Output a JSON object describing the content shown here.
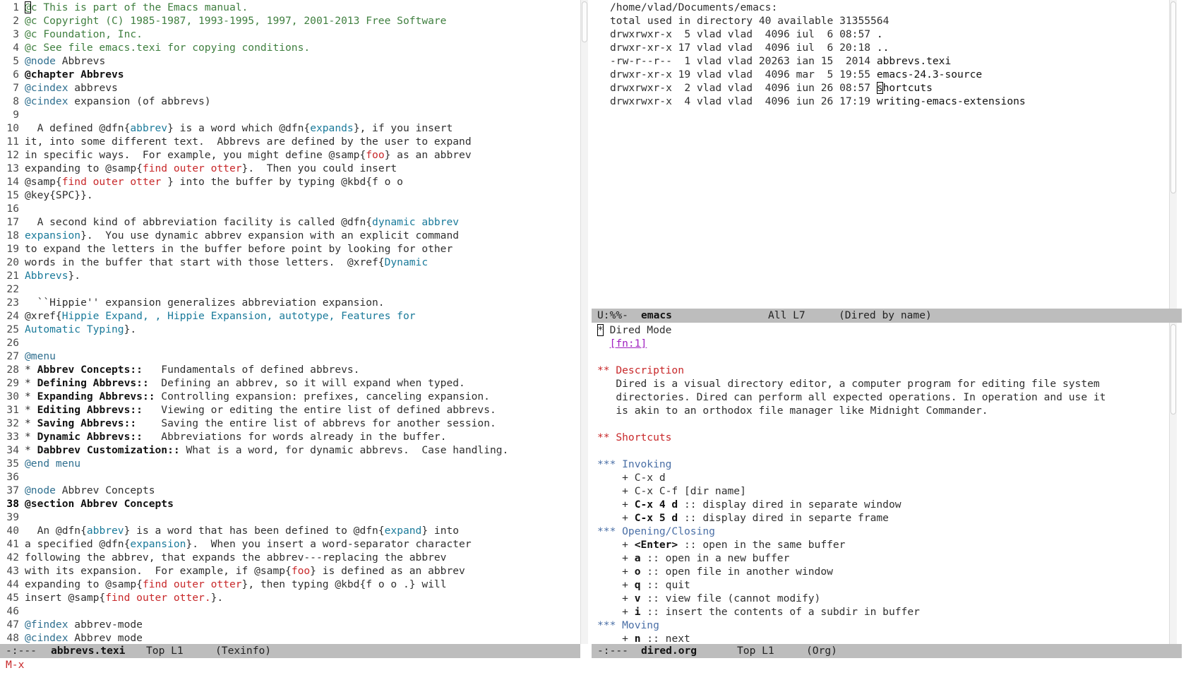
{
  "left_buffer": {
    "current_line": 38,
    "lines": [
      {
        "n": "1",
        "segs": [
          {
            "t": "@c This is part of the Emacs manual.",
            "c": "comment"
          }
        ]
      },
      {
        "n": "2",
        "segs": [
          {
            "t": "@c Copyright (C) 1985-1987, 1993-1995, 1997, 2001-2013 Free Software",
            "c": "comment"
          }
        ]
      },
      {
        "n": "3",
        "segs": [
          {
            "t": "@c Foundation, Inc.",
            "c": "comment"
          }
        ]
      },
      {
        "n": "4",
        "segs": [
          {
            "t": "@c See file emacs.texi for copying conditions.",
            "c": "comment"
          }
        ]
      },
      {
        "n": "5",
        "segs": [
          {
            "t": "@node",
            "c": "kw"
          },
          {
            "t": " Abbrevs",
            "c": "norm"
          }
        ]
      },
      {
        "n": "6",
        "segs": [
          {
            "t": "@chapter Abbrevs",
            "c": "bold"
          }
        ]
      },
      {
        "n": "7",
        "segs": [
          {
            "t": "@cindex",
            "c": "kw"
          },
          {
            "t": " abbrevs",
            "c": "norm"
          }
        ]
      },
      {
        "n": "8",
        "segs": [
          {
            "t": "@cindex",
            "c": "kw"
          },
          {
            "t": " expansion (of abbrevs)",
            "c": "norm"
          }
        ]
      },
      {
        "n": "9",
        "segs": []
      },
      {
        "n": "10",
        "segs": [
          {
            "t": "  A defined @dfn{",
            "c": "norm"
          },
          {
            "t": "abbrev",
            "c": "arg"
          },
          {
            "t": "} is a word which @dfn{",
            "c": "norm"
          },
          {
            "t": "expands",
            "c": "arg"
          },
          {
            "t": "}, if you insert",
            "c": "norm"
          }
        ]
      },
      {
        "n": "11",
        "segs": [
          {
            "t": "it, into some different text.  Abbrevs are defined by the user to expand",
            "c": "norm"
          }
        ]
      },
      {
        "n": "12",
        "segs": [
          {
            "t": "in specific ways.  For example, you might define @samp{",
            "c": "norm"
          },
          {
            "t": "foo",
            "c": "red"
          },
          {
            "t": "} as an abbrev",
            "c": "norm"
          }
        ]
      },
      {
        "n": "13",
        "segs": [
          {
            "t": "expanding to @samp{",
            "c": "norm"
          },
          {
            "t": "find outer otter",
            "c": "red"
          },
          {
            "t": "}.  Then you could insert",
            "c": "norm"
          }
        ]
      },
      {
        "n": "14",
        "segs": [
          {
            "t": "@samp{",
            "c": "norm"
          },
          {
            "t": "find outer otter ",
            "c": "red"
          },
          {
            "t": "} into the buffer by typing @kbd{f o o",
            "c": "norm"
          }
        ]
      },
      {
        "n": "15",
        "segs": [
          {
            "t": "@key{SPC}}.",
            "c": "norm"
          }
        ]
      },
      {
        "n": "16",
        "segs": []
      },
      {
        "n": "17",
        "segs": [
          {
            "t": "  A second kind of abbreviation facility is called @dfn{",
            "c": "norm"
          },
          {
            "t": "dynamic abbrev",
            "c": "arg"
          }
        ]
      },
      {
        "n": "18",
        "segs": [
          {
            "t": "expansion",
            "c": "arg"
          },
          {
            "t": "}.  You use dynamic abbrev expansion with an explicit command",
            "c": "norm"
          }
        ]
      },
      {
        "n": "19",
        "segs": [
          {
            "t": "to expand the letters in the buffer before point by looking for other",
            "c": "norm"
          }
        ]
      },
      {
        "n": "20",
        "segs": [
          {
            "t": "words in the buffer that start with those letters.  @xref{",
            "c": "norm"
          },
          {
            "t": "Dynamic",
            "c": "arg"
          }
        ]
      },
      {
        "n": "21",
        "segs": [
          {
            "t": "Abbrevs",
            "c": "arg"
          },
          {
            "t": "}.",
            "c": "norm"
          }
        ]
      },
      {
        "n": "22",
        "segs": []
      },
      {
        "n": "23",
        "segs": [
          {
            "t": "  ``Hippie'' expansion generalizes abbreviation expansion.",
            "c": "norm"
          }
        ]
      },
      {
        "n": "24",
        "segs": [
          {
            "t": "@xref{",
            "c": "norm"
          },
          {
            "t": "Hippie Expand, , Hippie Expansion, autotype, Features for",
            "c": "arg"
          }
        ]
      },
      {
        "n": "25",
        "segs": [
          {
            "t": "Automatic Typing",
            "c": "arg"
          },
          {
            "t": "}.",
            "c": "norm"
          }
        ]
      },
      {
        "n": "26",
        "segs": []
      },
      {
        "n": "27",
        "segs": [
          {
            "t": "@menu",
            "c": "kw"
          }
        ]
      },
      {
        "n": "28",
        "segs": [
          {
            "t": "* ",
            "c": "norm"
          },
          {
            "t": "Abbrev Concepts::",
            "c": "bold"
          },
          {
            "t": "   Fundamentals of defined abbrevs.",
            "c": "norm"
          }
        ]
      },
      {
        "n": "29",
        "segs": [
          {
            "t": "* ",
            "c": "norm"
          },
          {
            "t": "Defining Abbrevs::",
            "c": "bold"
          },
          {
            "t": "  Defining an abbrev, so it will expand when typed.",
            "c": "norm"
          }
        ]
      },
      {
        "n": "30",
        "segs": [
          {
            "t": "* ",
            "c": "norm"
          },
          {
            "t": "Expanding Abbrevs::",
            "c": "bold"
          },
          {
            "t": " Controlling expansion: prefixes, canceling expansion.",
            "c": "norm"
          }
        ]
      },
      {
        "n": "31",
        "segs": [
          {
            "t": "* ",
            "c": "norm"
          },
          {
            "t": "Editing Abbrevs::",
            "c": "bold"
          },
          {
            "t": "   Viewing or editing the entire list of defined abbrevs.",
            "c": "norm"
          }
        ]
      },
      {
        "n": "32",
        "segs": [
          {
            "t": "* ",
            "c": "norm"
          },
          {
            "t": "Saving Abbrevs::",
            "c": "bold"
          },
          {
            "t": "    Saving the entire list of abbrevs for another session.",
            "c": "norm"
          }
        ]
      },
      {
        "n": "33",
        "segs": [
          {
            "t": "* ",
            "c": "norm"
          },
          {
            "t": "Dynamic Abbrevs::",
            "c": "bold"
          },
          {
            "t": "   Abbreviations for words already in the buffer.",
            "c": "norm"
          }
        ]
      },
      {
        "n": "34",
        "segs": [
          {
            "t": "* ",
            "c": "norm"
          },
          {
            "t": "Dabbrev Customization::",
            "c": "bold"
          },
          {
            "t": " What is a word, for dynamic abbrevs.  Case handling.",
            "c": "norm"
          }
        ]
      },
      {
        "n": "35",
        "segs": [
          {
            "t": "@end menu",
            "c": "kw"
          }
        ]
      },
      {
        "n": "36",
        "segs": []
      },
      {
        "n": "37",
        "segs": [
          {
            "t": "@node",
            "c": "kw"
          },
          {
            "t": " Abbrev Concepts",
            "c": "norm"
          }
        ]
      },
      {
        "n": "38",
        "segs": [
          {
            "t": "@section Abbrev Concepts",
            "c": "bold"
          }
        ]
      },
      {
        "n": "39",
        "segs": []
      },
      {
        "n": "40",
        "segs": [
          {
            "t": "  An @dfn{",
            "c": "norm"
          },
          {
            "t": "abbrev",
            "c": "arg"
          },
          {
            "t": "} is a word that has been defined to @dfn{",
            "c": "norm"
          },
          {
            "t": "expand",
            "c": "arg"
          },
          {
            "t": "} into",
            "c": "norm"
          }
        ]
      },
      {
        "n": "41",
        "segs": [
          {
            "t": "a specified @dfn{",
            "c": "norm"
          },
          {
            "t": "expansion",
            "c": "arg"
          },
          {
            "t": "}.  When you insert a word-separator character",
            "c": "norm"
          }
        ]
      },
      {
        "n": "42",
        "segs": [
          {
            "t": "following the abbrev, that expands the abbrev---replacing the abbrev",
            "c": "norm"
          }
        ]
      },
      {
        "n": "43",
        "segs": [
          {
            "t": "with its expansion.  For example, if @samp{",
            "c": "norm"
          },
          {
            "t": "foo",
            "c": "red"
          },
          {
            "t": "} is defined as an abbrev",
            "c": "norm"
          }
        ]
      },
      {
        "n": "44",
        "segs": [
          {
            "t": "expanding to @samp{",
            "c": "norm"
          },
          {
            "t": "find outer otter",
            "c": "red"
          },
          {
            "t": "}, then typing @kbd{f o o .} will",
            "c": "norm"
          }
        ]
      },
      {
        "n": "45",
        "segs": [
          {
            "t": "insert @samp{",
            "c": "norm"
          },
          {
            "t": "find outer otter.",
            "c": "red"
          },
          {
            "t": "}.",
            "c": "norm"
          }
        ]
      },
      {
        "n": "46",
        "segs": []
      },
      {
        "n": "47",
        "segs": [
          {
            "t": "@findex",
            "c": "kw"
          },
          {
            "t": " abbrev-mode",
            "c": "norm"
          }
        ]
      },
      {
        "n": "48",
        "segs": [
          {
            "t": "@cindex",
            "c": "kw"
          },
          {
            "t": " Abbrev mode",
            "c": "norm"
          }
        ]
      }
    ],
    "modeline": {
      "state": "-:---",
      "buffer": "abbrevs.texi",
      "pos": "Top L1",
      "mode": "(Texinfo)"
    }
  },
  "dired_buffer": {
    "header": "/home/vlad/Documents/emacs:",
    "total": "total used in directory 40 available 31355564",
    "entries": [
      {
        "meta": "drwxrwxr-x  5 vlad vlad  4096 iul  6 08:57 ",
        "name": "."
      },
      {
        "meta": "drwxr-xr-x 17 vlad vlad  4096 iul  6 20:18 ",
        "name": ".."
      },
      {
        "meta": "-rw-r--r--  1 vlad vlad 20263 ian 15  2014 ",
        "name": "abbrevs.texi"
      },
      {
        "meta": "drwxr-xr-x 19 vlad vlad  4096 mar  5 19:55 ",
        "name": "emacs-24.3-source"
      },
      {
        "meta": "drwxrwxr-x  2 vlad vlad  4096 iun 26 08:57 ",
        "name": "shortcuts"
      },
      {
        "meta": "drwxrwxr-x  4 vlad vlad  4096 iun 26 17:19 ",
        "name": "writing-emacs-extensions"
      }
    ],
    "modeline": {
      "state": "U:%%-",
      "buffer": "emacs",
      "pos": "All L7",
      "mode": "(Dired by name)"
    }
  },
  "org_buffer": {
    "lines": [
      {
        "segs": [
          {
            "t": "*",
            "c": "norm",
            "cursor": true
          },
          {
            "t": " Dired Mode",
            "c": "norm"
          }
        ]
      },
      {
        "segs": [
          {
            "t": "  ",
            "c": "norm"
          },
          {
            "t": "[fn:1]",
            "c": "link"
          }
        ]
      },
      {
        "segs": []
      },
      {
        "segs": [
          {
            "t": "** Description",
            "c": "h1"
          }
        ]
      },
      {
        "segs": [
          {
            "t": "   Dired is a visual directory editor, a computer program for editing file system",
            "c": "norm"
          }
        ]
      },
      {
        "segs": [
          {
            "t": "   directories. Dired can perform all expected operations. In operation and use it",
            "c": "norm"
          }
        ]
      },
      {
        "segs": [
          {
            "t": "   is akin to an orthodox file manager like Midnight Commander.",
            "c": "norm"
          }
        ]
      },
      {
        "segs": []
      },
      {
        "segs": [
          {
            "t": "** Shortcuts",
            "c": "h1"
          }
        ]
      },
      {
        "segs": []
      },
      {
        "segs": [
          {
            "t": "*** Invoking",
            "c": "h3"
          }
        ]
      },
      {
        "segs": [
          {
            "t": "    + C-x d",
            "c": "norm"
          }
        ]
      },
      {
        "segs": [
          {
            "t": "    + C-x C-f [dir name]",
            "c": "norm"
          }
        ]
      },
      {
        "segs": [
          {
            "t": "    + ",
            "c": "norm"
          },
          {
            "t": "C-x 4 d",
            "c": "bold"
          },
          {
            "t": " :: display dired in separate window",
            "c": "norm"
          }
        ]
      },
      {
        "segs": [
          {
            "t": "    + ",
            "c": "norm"
          },
          {
            "t": "C-x 5 d",
            "c": "bold"
          },
          {
            "t": " :: display dired in separte frame",
            "c": "norm"
          }
        ]
      },
      {
        "segs": [
          {
            "t": "*** Opening/Closing",
            "c": "h3"
          }
        ]
      },
      {
        "segs": [
          {
            "t": "    + ",
            "c": "norm"
          },
          {
            "t": "<Enter>",
            "c": "bold"
          },
          {
            "t": " :: open in the same buffer",
            "c": "norm"
          }
        ]
      },
      {
        "segs": [
          {
            "t": "    + ",
            "c": "norm"
          },
          {
            "t": "a",
            "c": "bold"
          },
          {
            "t": " :: open in a new buffer",
            "c": "norm"
          }
        ]
      },
      {
        "segs": [
          {
            "t": "    + ",
            "c": "norm"
          },
          {
            "t": "o",
            "c": "bold"
          },
          {
            "t": " :: open file in another window",
            "c": "norm"
          }
        ]
      },
      {
        "segs": [
          {
            "t": "    + ",
            "c": "norm"
          },
          {
            "t": "q",
            "c": "bold"
          },
          {
            "t": " :: quit",
            "c": "norm"
          }
        ]
      },
      {
        "segs": [
          {
            "t": "    + ",
            "c": "norm"
          },
          {
            "t": "v",
            "c": "bold"
          },
          {
            "t": " :: view file (cannot modify)",
            "c": "norm"
          }
        ]
      },
      {
        "segs": [
          {
            "t": "    + ",
            "c": "norm"
          },
          {
            "t": "i",
            "c": "bold"
          },
          {
            "t": " :: insert the contents of a subdir in buffer",
            "c": "norm"
          }
        ]
      },
      {
        "segs": [
          {
            "t": "*** Moving",
            "c": "h3"
          }
        ]
      },
      {
        "segs": [
          {
            "t": "    + ",
            "c": "norm"
          },
          {
            "t": "n",
            "c": "bold"
          },
          {
            "t": " :: next",
            "c": "norm"
          }
        ]
      }
    ],
    "modeline": {
      "state": "-:---",
      "buffer": "dired.org",
      "pos": "Top L1",
      "mode": "(Org)"
    }
  },
  "echo_area": "M-x",
  "colors": {
    "comment": "#3f7f3f",
    "keyword": "#2f6f8f",
    "argument": "#1a7a9a",
    "string": "#c8282a",
    "org_h3": "#4a6fa6",
    "link": "#a020c0",
    "modeline_bg": "#bdbdbd"
  }
}
